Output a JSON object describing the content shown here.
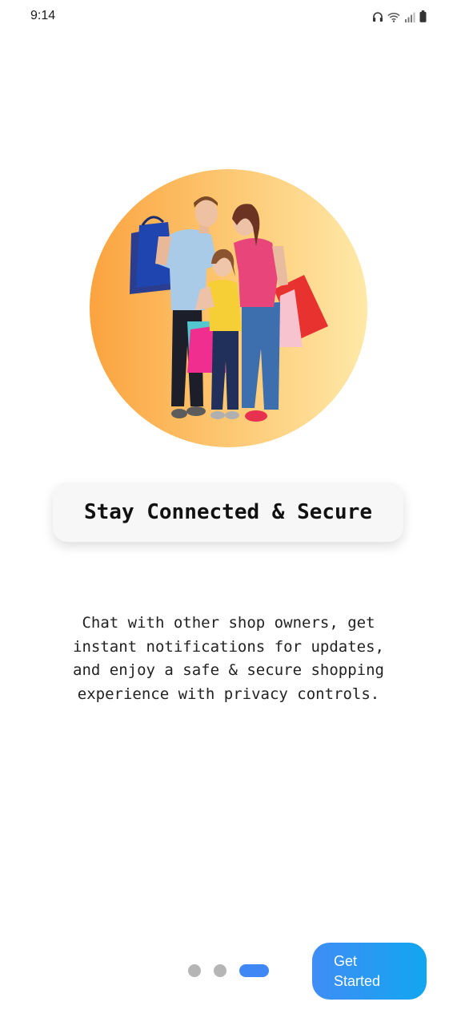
{
  "status_bar": {
    "time": "9:14",
    "icons": [
      "headphones-icon",
      "wifi-icon",
      "signal-icon",
      "battery-icon"
    ]
  },
  "onboarding": {
    "title": "Stay Connected & Secure",
    "description": "Chat with other shop owners, get\ninstant notifications for updates,\nand enjoy a safe & secure shopping\nexperience with privacy controls.",
    "page_indicator": {
      "total": 3,
      "current": 3
    },
    "cta_label": "Get\nStarted"
  },
  "colors": {
    "accent": "#3f87f5",
    "button_gradient_start": "#3f8df5",
    "button_gradient_end": "#12a6f0",
    "hero_gradient_start": "#fba33f",
    "hero_gradient_end": "#fee9a8",
    "inactive_dot": "#b5b5b5"
  }
}
